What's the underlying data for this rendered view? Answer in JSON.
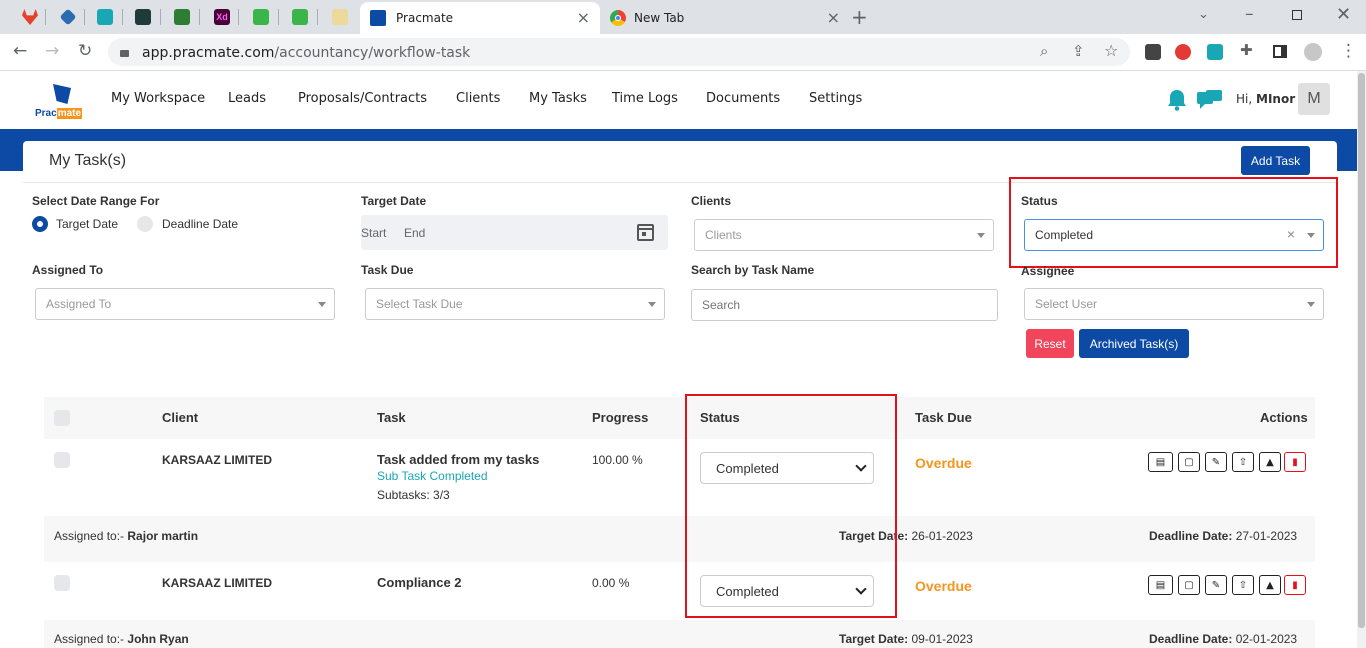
{
  "browser": {
    "active_tab_title": "Pracmate",
    "other_tab_title": "New Tab",
    "url_host": "app.pracmate.com",
    "url_path": "/accountancy/workflow-task",
    "new_tab_symbol": "+"
  },
  "app": {
    "logo_text_a": "Prac",
    "logo_text_b": "mate",
    "menu": [
      "My Workspace",
      "Leads",
      "Proposals/Contracts",
      "Clients",
      "My Tasks",
      "Time Logs",
      "Documents",
      "Settings"
    ],
    "greeting": "Hi,",
    "user_name": "MInor",
    "avatar_letter": "M"
  },
  "page": {
    "title": "My Task(s)",
    "add_task_label": "Add Task"
  },
  "filters": {
    "date_range_label": "Select Date Range For",
    "radio_target": "Target Date",
    "radio_deadline": "Deadline Date",
    "target_date_label": "Target Date",
    "start_label": "Start",
    "end_label": "End",
    "clients_label": "Clients",
    "clients_placeholder": "Clients",
    "status_label": "Status",
    "status_value": "Completed",
    "status_clear": "×",
    "assigned_to_label": "Assigned To",
    "assigned_to_placeholder": "Assigned To",
    "task_due_label": "Task Due",
    "task_due_placeholder": "Select Task Due",
    "search_label": "Search by Task Name",
    "search_placeholder": "Search",
    "assignee_label": "Assignee",
    "assignee_placeholder": "Select User",
    "reset_label": "Reset",
    "archived_label": "Archived Task(s)"
  },
  "table": {
    "headers": {
      "client": "Client",
      "task": "Task",
      "progress": "Progress",
      "status": "Status",
      "task_due": "Task Due",
      "actions": "Actions"
    },
    "rows": [
      {
        "client": "KARSAAZ LIMITED",
        "task": "Task added from my tasks",
        "subtask_status": "Sub Task Completed",
        "subtasks": "Subtasks: 3/3",
        "progress": "100.00 %",
        "status": "Completed",
        "task_due": "Overdue",
        "assigned_prefix": "Assigned to:-",
        "assigned_name": "Rajor martin",
        "target_label": "Target Date:",
        "target_value": "26-01-2023",
        "deadline_label": "Deadline Date:",
        "deadline_value": "27-01-2023"
      },
      {
        "client": "KARSAAZ LIMITED",
        "task": "Compliance 2",
        "progress": "0.00 %",
        "status": "Completed",
        "task_due": "Overdue",
        "assigned_prefix": "Assigned to:-",
        "assigned_name": "John Ryan",
        "target_label": "Target Date:",
        "target_value": "09-01-2023",
        "deadline_label": "Deadline Date:",
        "deadline_value": "02-01-2023"
      }
    ]
  },
  "colors": {
    "brand_blue": "#0d4aa6",
    "reset_red": "#f0455a",
    "overdue_orange": "#f7941d",
    "highlight_red": "#e3121a",
    "notify_teal": "#1aa7b5"
  }
}
